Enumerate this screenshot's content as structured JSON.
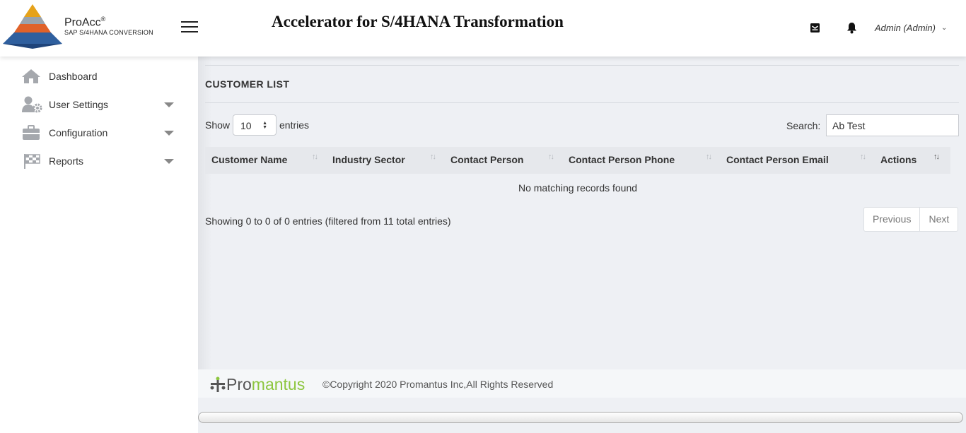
{
  "brand": {
    "name": "ProAcc",
    "reg": "®",
    "subtitle": "SAP S/4HANA CONVERSION"
  },
  "header": {
    "title": "Accelerator for S/4HANA Transformation",
    "user": "Admin (Admin)",
    "icons": [
      "mail-icon",
      "bell-icon",
      "chevron-down-icon",
      "menu-icon"
    ]
  },
  "sidebar": {
    "items": [
      {
        "label": "Dashboard",
        "icon": "home-icon"
      },
      {
        "label": "User Settings",
        "icon": "user-gear-icon"
      },
      {
        "label": "Configuration",
        "icon": "briefcase-icon"
      },
      {
        "label": "Reports",
        "icon": "checkered-flag-icon"
      }
    ]
  },
  "main": {
    "section_title": "CUSTOMER LIST",
    "show_label": "Show",
    "entries_value": "10",
    "entries_label": "entries",
    "search_label": "Search:",
    "search_value": "Ab Test",
    "columns": [
      "Customer Name",
      "Industry Sector",
      "Contact Person",
      "Contact Person Phone",
      "Contact Person Email",
      "Actions"
    ],
    "empty_message": "No matching records found",
    "info": "Showing 0 to 0 of 0 entries (filtered from 11 total entries)",
    "pagination": {
      "previous": "Previous",
      "next": "Next"
    }
  },
  "footer": {
    "logo_pro": "Pro",
    "logo_mantus": "mantus",
    "copyright": "©Copyright 2020 Promantus Inc,All Rights Reserved"
  },
  "colors": {
    "main_bg": "#eef0f4",
    "accent_green": "#8dc63f",
    "table_header_bg": "#e6e8ec"
  }
}
